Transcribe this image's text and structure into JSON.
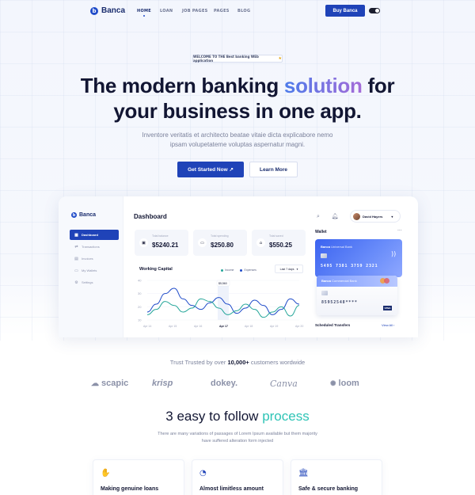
{
  "nav": {
    "logo_text": "Banca",
    "logo_initial": "b",
    "items": [
      "HOME",
      "LOAN",
      "JOB PAGES",
      "PAGES",
      "BLOG"
    ],
    "cta": "Buy Banca"
  },
  "hero": {
    "badge": "WELCOME TO THE Best banking WEb application",
    "badge_icon": "star-icon",
    "title_part1": "The modern banking ",
    "title_accent": "solution",
    "title_part2": " for",
    "title_line2": "your business in one app.",
    "subtitle": "Inventore veritatis et architecto beatae vitaie dicta explicabore nemo ipsam volupetateme voluptas aspernatur magni.",
    "primary_button": "Get Started Now ↗",
    "secondary_button": "Learn More"
  },
  "dashboard": {
    "logo_text": "Banca",
    "title": "Dashboard",
    "user_name": "David Hayers",
    "sidebar": [
      {
        "label": "Dashboard",
        "icon": "grid-icon",
        "active": true
      },
      {
        "label": "Transactions",
        "icon": "transactions-icon",
        "active": false
      },
      {
        "label": "Invoices",
        "icon": "invoice-icon",
        "active": false
      },
      {
        "label": "My Wallets",
        "icon": "wallet-icon",
        "active": false
      },
      {
        "label": "Settings",
        "icon": "gear-icon",
        "active": false
      }
    ],
    "stats": [
      {
        "label": "Total balance",
        "value": "$5240.21",
        "icon": "wallet-icon"
      },
      {
        "label": "Total spending",
        "value": "$250.80",
        "icon": "card-icon"
      },
      {
        "label": "Total saved",
        "value": "$550.25",
        "icon": "home-icon"
      }
    ],
    "chart_title": "Working Capital",
    "legend": [
      "Income",
      "Expenses"
    ],
    "period": "Last 7 days",
    "tooltip": "$5,560",
    "wallet_title": "Wallet",
    "card1": {
      "brand": "Banca",
      "bank": "Universal Bank",
      "number": "5495 7381 3759 2321"
    },
    "card2": {
      "brand": "Banca",
      "bank": "Commercial Bank",
      "number": "85952548****",
      "network": "VISA"
    },
    "scheduled": "Scheduled Transfers",
    "view_all": "View All ›"
  },
  "chart_data": {
    "type": "line",
    "title": "Working Capital",
    "x": [
      "Apr 14",
      "Apr 15",
      "Apr 16",
      "Apr 17",
      "Apr 18",
      "Apr 19",
      "Apr 20"
    ],
    "ylim": [
      10,
      40
    ],
    "y_ticks": [
      "40",
      "30",
      "20",
      "10"
    ],
    "highlight": "Apr 17",
    "series": [
      {
        "name": "Income",
        "color": "#1f4bc9",
        "values": [
          16,
          22,
          30,
          34,
          26,
          21,
          18,
          23,
          27,
          22,
          15,
          19,
          25,
          21,
          14,
          18,
          26,
          22
        ]
      },
      {
        "name": "Expenses",
        "color": "#26a69a",
        "values": [
          14,
          18,
          24,
          21,
          16,
          19,
          26,
          24,
          19,
          14,
          17,
          22,
          18,
          12,
          16,
          20,
          13,
          21
        ]
      }
    ]
  },
  "trust": {
    "prefix": "Trust Trusted by over ",
    "bold": "10,000+",
    "suffix": " customers wordwide",
    "brands": [
      "scapic",
      "krisp",
      "dokey.",
      "Canva",
      "loom"
    ]
  },
  "process": {
    "title_part1": "3 easy to follow ",
    "title_accent": "process",
    "subtitle": "There are many variations of passages of Lorem Ipsum available but them majority have suffered alteration form injected",
    "features": [
      {
        "title": "Making genuine loans",
        "icon": "hand-coin-icon"
      },
      {
        "title": "Almost limitless amount",
        "icon": "coin-hand-icon"
      },
      {
        "title": "Safe & secure banking",
        "icon": "bank-icon"
      }
    ]
  },
  "colors": {
    "primary": "#1f43b8",
    "accent_gradient_start": "#4c7bea",
    "accent_gradient_end": "#a56bd8",
    "teal": "#2ec4b6"
  }
}
